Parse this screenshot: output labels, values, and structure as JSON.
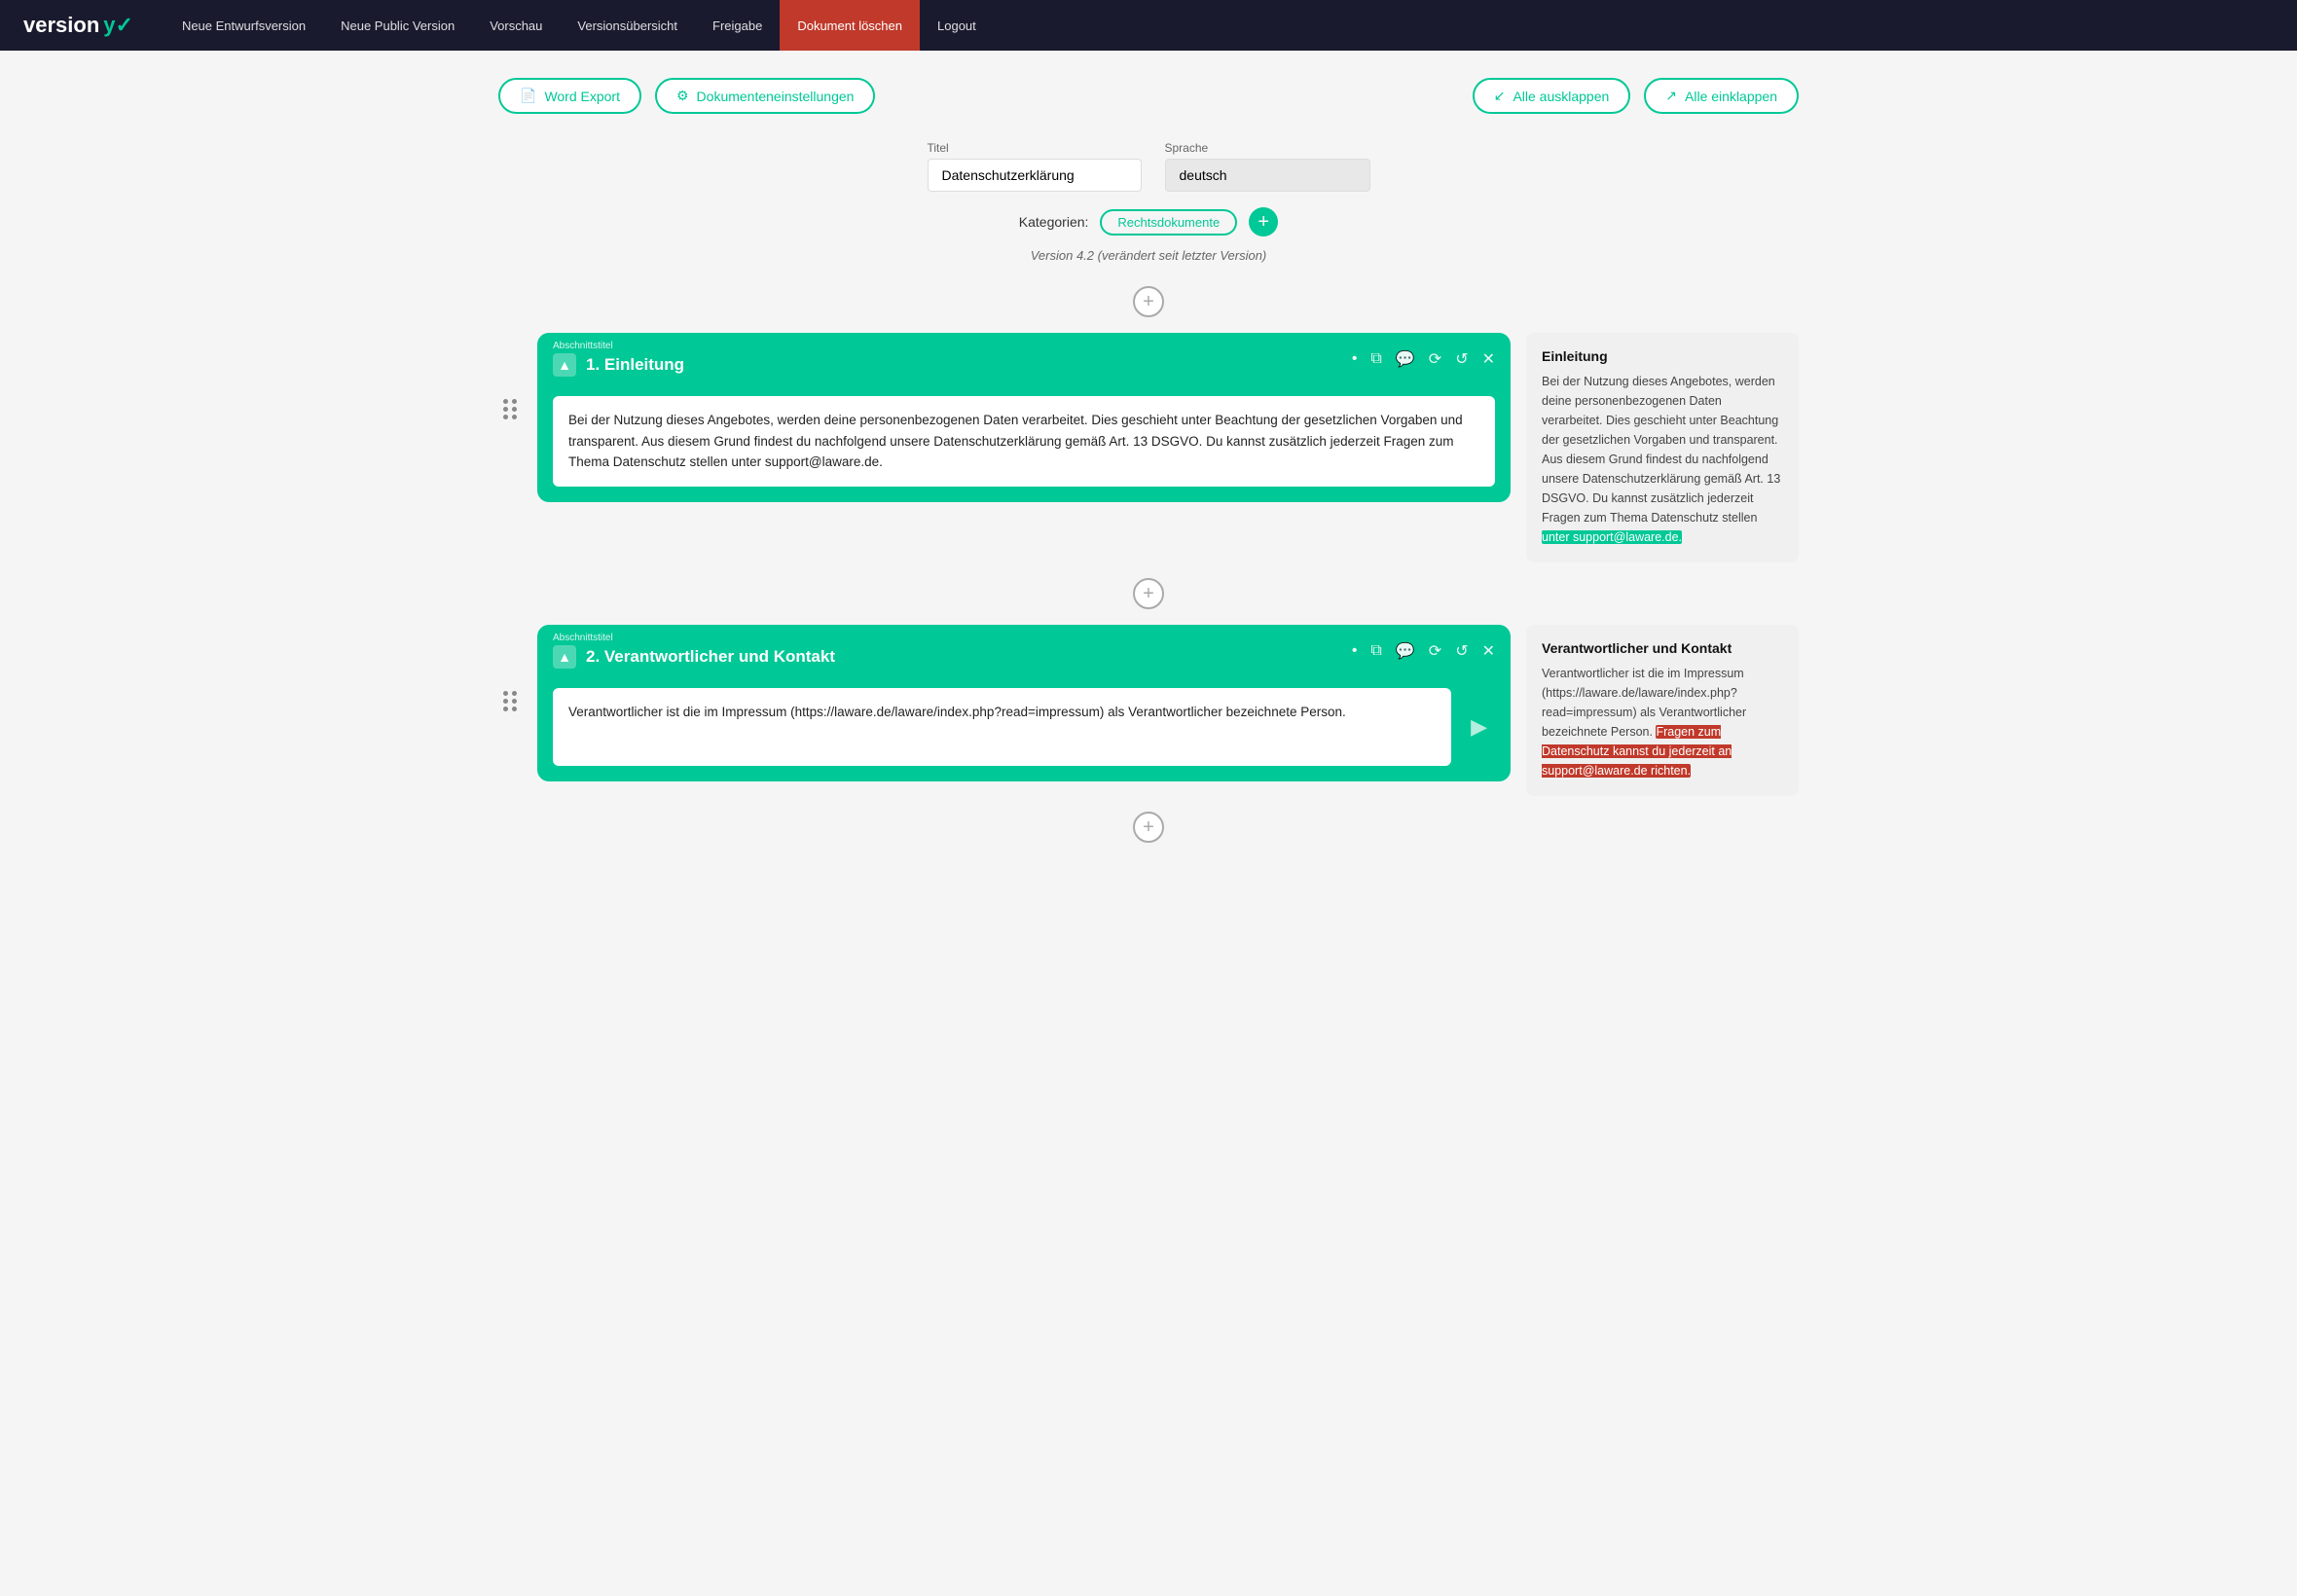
{
  "navbar": {
    "logo": "versiony",
    "logo_suffix": "✓",
    "nav_items": [
      {
        "label": "Neue Entwurfsversion",
        "href": "#",
        "active": false,
        "danger": false
      },
      {
        "label": "Neue Public Version",
        "href": "#",
        "active": false,
        "danger": false
      },
      {
        "label": "Vorschau",
        "href": "#",
        "active": false,
        "danger": false
      },
      {
        "label": "Versionsübersicht",
        "href": "#",
        "active": false,
        "danger": false
      },
      {
        "label": "Freigabe",
        "href": "#",
        "active": false,
        "danger": false
      },
      {
        "label": "Dokument löschen",
        "href": "#",
        "active": false,
        "danger": true
      },
      {
        "label": "Logout",
        "href": "#",
        "active": false,
        "danger": false
      }
    ]
  },
  "toolbar": {
    "word_export_label": "Word Export",
    "doc_settings_label": "Dokumenteneinstellungen",
    "expand_all_label": "Alle ausklappen",
    "collapse_all_label": "Alle einklappen"
  },
  "document": {
    "title_label": "Titel",
    "title_value": "Datenschutzerklärung",
    "language_label": "Sprache",
    "language_value": "deutsch",
    "categories_label": "Kategorien:",
    "category_tag": "Rechtsdokumente",
    "version_text": "Version 4.2 (verändert seit letzter Version)"
  },
  "sections": [
    {
      "id": "section-1",
      "subtitle": "Abschnittstitel",
      "title": "1.  Einleitung",
      "content": "Bei der Nutzung dieses Angebotes, werden deine personenbezogenen Daten verarbeitet. Dies geschieht unter Beachtung der gesetzlichen Vorgaben und transparent. Aus diesem Grund findest du nachfolgend unsere Datenschutzerklärung gemäß Art. 13 DSGVO. Du kannst zusätzlich jederzeit Fragen zum Thema Datenschutz stellen unter support@laware.de.",
      "preview_title": "Einleitung",
      "preview_body_before": "Bei der Nutzung dieses Angebotes, werden deine personenbezogenen Daten verarbeitet. Dies geschieht unter Beachtung der gesetzlichen Vorgaben und transparent. Aus diesem Grund findest du nachfolgend unsere Datenschutzerklärung gemäß Art. 13 DSGVO. Du kannst zusätzlich jederzeit Fragen zum Thema Datenschutz stellen ",
      "preview_highlight_green": "unter support@laware.de.",
      "preview_body_after": "",
      "highlight_color": "green"
    },
    {
      "id": "section-2",
      "subtitle": "Abschnittstitel",
      "title": "2.  Verantwortlicher und Kontakt",
      "content": "Verantwortlicher ist die im Impressum (https://laware.de/laware/index.php?read=impressum) als Verantwortlicher bezeichnete Person.",
      "preview_title": "Verantwortlicher und Kontakt",
      "preview_body_before": "Verantwortlicher ist die im Impressum (https://laware.de/laware/index.php?read=impressum) als Verantwortlicher bezeichnete Person. ",
      "preview_highlight_red": "Fragen zum Datenschutz kannst du jederzeit an support@laware.de richten.",
      "preview_body_after": "",
      "highlight_color": "red"
    }
  ],
  "icons": {
    "word_export": "📄",
    "settings": "⚙",
    "expand": "↙",
    "collapse": "↗",
    "bullet": "•",
    "copy": "⧉",
    "comment": "💬",
    "history": "⟳",
    "undo": "↺",
    "close": "✕",
    "up_arrow": "▲",
    "right_arrow": "▶",
    "plus": "+"
  }
}
